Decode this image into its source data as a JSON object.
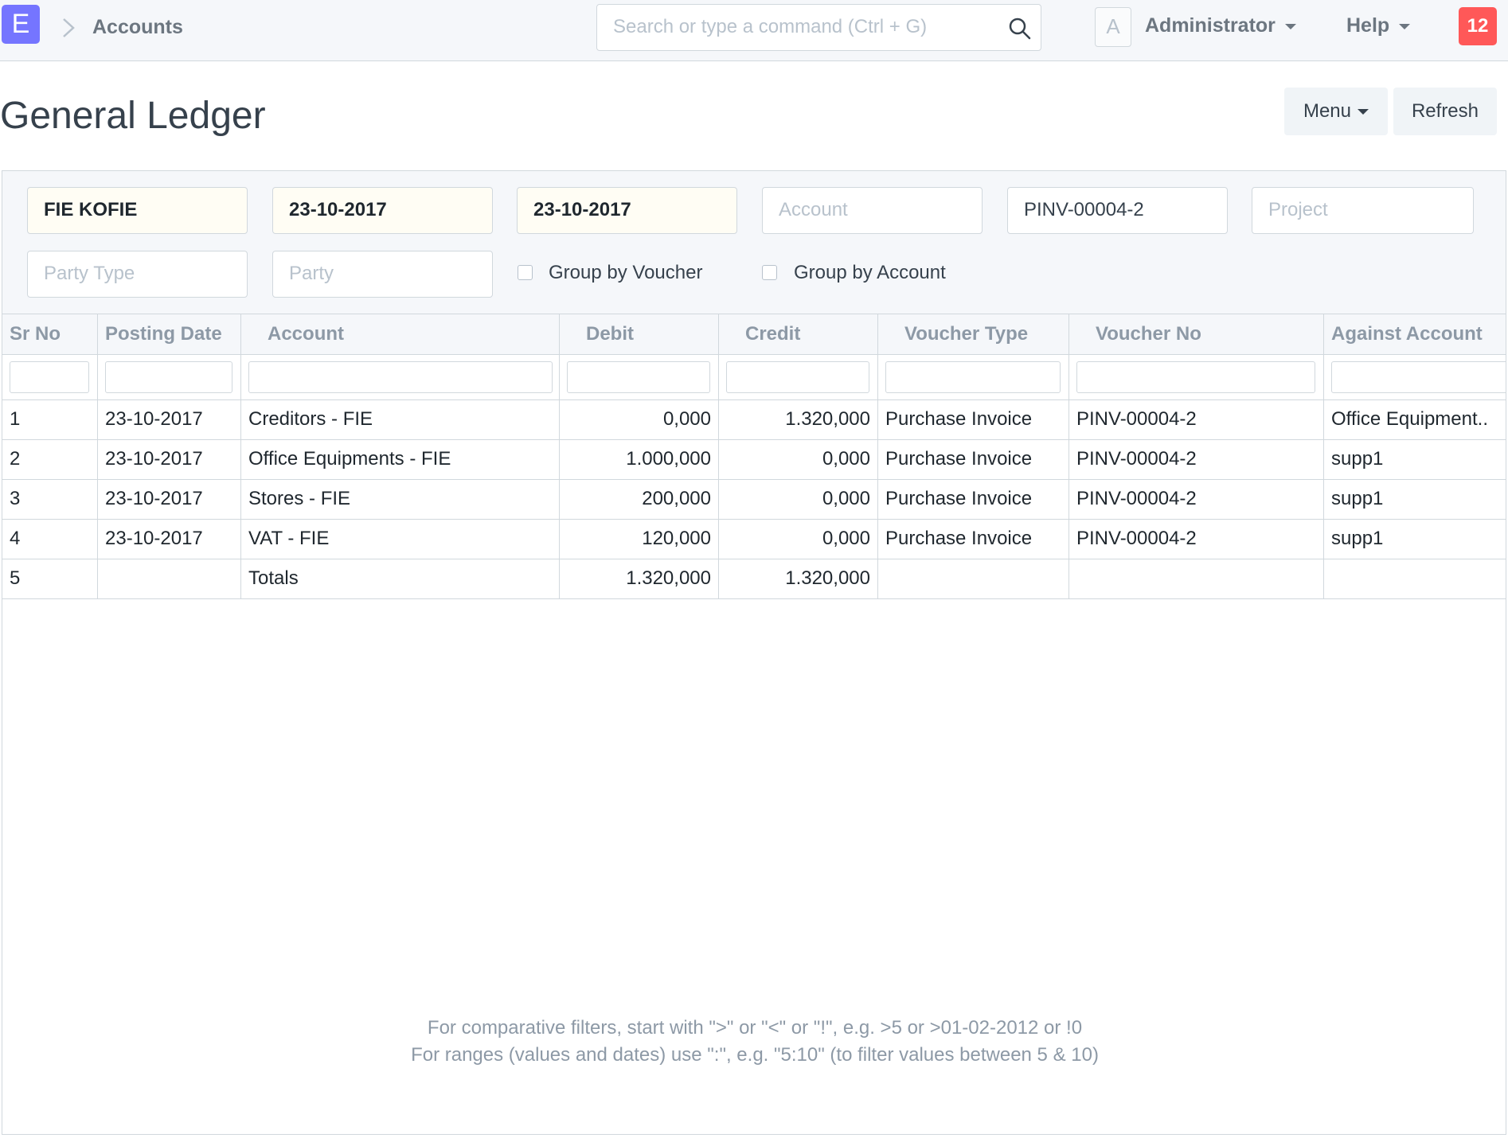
{
  "navbar": {
    "logo_letter": "E",
    "breadcrumb": "Accounts",
    "search_placeholder": "Search or type a command (Ctrl + G)",
    "avatar_letter": "A",
    "user_label": "Administrator",
    "help_label": "Help",
    "notification_count": "12"
  },
  "page": {
    "title": "General Ledger",
    "menu_label": "Menu",
    "refresh_label": "Refresh"
  },
  "filters": {
    "company": "FIE KOFIE",
    "from_date": "23-10-2017",
    "to_date": "23-10-2017",
    "account_placeholder": "Account",
    "voucher_no": "PINV-00004-2",
    "project_placeholder": "Project",
    "party_type_placeholder": "Party Type",
    "party_placeholder": "Party",
    "group_by_voucher_label": "Group by Voucher",
    "group_by_account_label": "Group by Account"
  },
  "table": {
    "columns": [
      "Sr No",
      "Posting Date",
      "Account",
      "Debit",
      "Credit",
      "Voucher Type",
      "Voucher No",
      "Against Account"
    ],
    "rows": [
      [
        "1",
        "23-10-2017",
        "Creditors - FIE",
        "0,000",
        "1.320,000",
        "Purchase Invoice",
        "PINV-00004-2",
        "Office Equipment.."
      ],
      [
        "2",
        "23-10-2017",
        "Office Equipments - FIE",
        "1.000,000",
        "0,000",
        "Purchase Invoice",
        "PINV-00004-2",
        "supp1"
      ],
      [
        "3",
        "23-10-2017",
        "Stores - FIE",
        "200,000",
        "0,000",
        "Purchase Invoice",
        "PINV-00004-2",
        "supp1"
      ],
      [
        "4",
        "23-10-2017",
        "VAT - FIE",
        "120,000",
        "0,000",
        "Purchase Invoice",
        "PINV-00004-2",
        "supp1"
      ],
      [
        "5",
        "",
        "Totals",
        "1.320,000",
        "1.320,000",
        "",
        "",
        ""
      ]
    ]
  },
  "hints": {
    "line1": "For comparative filters, start with \">\" or \"<\" or \"!\", e.g. >5 or >01-02-2012 or !0",
    "line2": "For ranges (values and dates) use \":\", e.g. \"5:10\" (to filter values between 5 & 10)"
  }
}
